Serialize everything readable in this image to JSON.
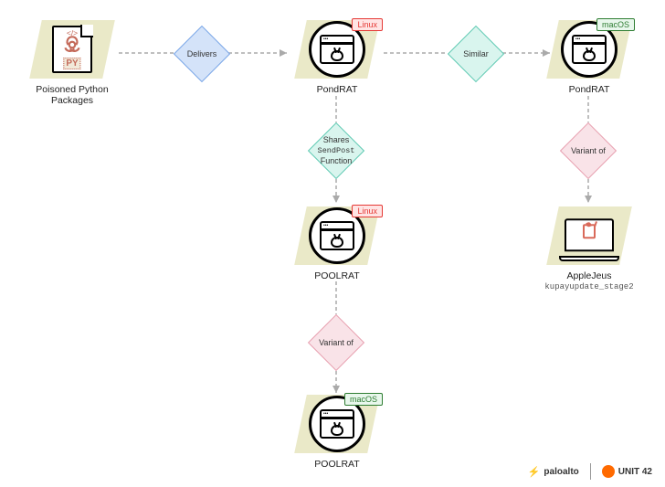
{
  "diagram": {
    "nodes": {
      "poisoned": {
        "label": "Poisoned Python Packages",
        "py_tag": "PY",
        "code_tag": "</>"
      },
      "pondrat_linux": {
        "label": "PondRAT",
        "os": "Linux"
      },
      "pondrat_macos": {
        "label": "PondRAT",
        "os": "macOS"
      },
      "poolrat_linux": {
        "label": "POOLRAT",
        "os": "Linux"
      },
      "poolrat_macos": {
        "label": "POOLRAT",
        "os": "macOS"
      },
      "applejeus": {
        "label": "AppleJeus",
        "sublabel": "kupayupdate_stage2"
      }
    },
    "edges": {
      "delivers": {
        "label": "Delivers"
      },
      "similar": {
        "label": "Similar"
      },
      "shares": {
        "line1": "Shares",
        "line2_mono": "SendPost",
        "line3": "Function"
      },
      "variant1": {
        "label": "Variant of"
      },
      "variant2": {
        "label": "Variant of"
      }
    }
  },
  "footer": {
    "brand1": "paloalto",
    "brand2": "UNIT 42"
  }
}
